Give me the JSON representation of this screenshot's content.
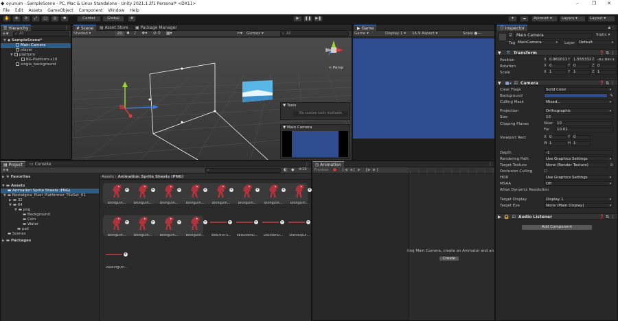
{
  "window": {
    "title": "oyunum - SampleScene - PC, Mac & Linux Standalone - Unity 2021.1.2f1 Personal* <DX11>",
    "controls": [
      "–",
      "❐",
      "✕"
    ]
  },
  "menu": [
    "File",
    "Edit",
    "Assets",
    "GameObject",
    "Component",
    "Window",
    "Help"
  ],
  "toolbar": {
    "pivot_label": "Center",
    "space_label": "Global",
    "account_label": "Account",
    "layers_label": "Layers",
    "layout_label": "Layout"
  },
  "hierarchy": {
    "tab": "Hierarchy",
    "search_placeholder": "All",
    "scene": "SampleScene*",
    "items": [
      {
        "label": "Main Camera",
        "indent": 2,
        "selected": true
      },
      {
        "label": "player",
        "indent": 2
      },
      {
        "label": "platform",
        "indent": 2,
        "expandable": true
      },
      {
        "label": "BG-Platform-x10",
        "indent": 3
      },
      {
        "label": "single_background",
        "indent": 2
      }
    ]
  },
  "scene_view": {
    "tabs": [
      "Scene",
      "Asset Store",
      "Package Manager"
    ],
    "shading": "Shaded",
    "mode_2d": "2D",
    "gizmos": "Gizmos",
    "search_placeholder": "All",
    "persp_label": "< Persp",
    "tools_overlay": {
      "title": "Tools",
      "message": "No custom tools available"
    },
    "camera_preview_title": "Main Camera"
  },
  "game_view": {
    "tab": "Game",
    "game_dropdown": "Game",
    "display": "Display 1",
    "aspect": "16:9 Aspect",
    "scale_label": "Scale"
  },
  "inspector": {
    "tab": "Inspector",
    "object_name": "Main Camera",
    "static_label": "Static",
    "tag_label": "Tag",
    "tag_value": "MainCamera",
    "layer_label": "Layer",
    "layer_value": "Default",
    "transform": {
      "title": "Transform",
      "position": {
        "label": "Position",
        "x": "0.961011",
        "y": "1.555332",
        "z": "-82.8973"
      },
      "rotation": {
        "label": "Rotation",
        "x": "0",
        "y": "0",
        "z": "0"
      },
      "scale": {
        "label": "Scale",
        "x": "1",
        "y": "1",
        "z": "1"
      }
    },
    "camera": {
      "title": "Camera",
      "clear_flags": {
        "label": "Clear Flags",
        "value": "Solid Color"
      },
      "background": {
        "label": "Background",
        "color": "#2f4d8f"
      },
      "culling_mask": {
        "label": "Culling Mask",
        "value": "Mixed..."
      },
      "projection": {
        "label": "Projection",
        "value": "Orthographic"
      },
      "size": {
        "label": "Size",
        "value": "10"
      },
      "clipping": {
        "label": "Clipping Planes",
        "near_label": "Near",
        "near": "10",
        "far_label": "Far",
        "far": "10.01"
      },
      "viewport": {
        "label": "Viewport Rect",
        "x": "0",
        "y": "0",
        "w": "1",
        "h": "1"
      },
      "depth": {
        "label": "Depth",
        "value": "-1"
      },
      "rendering_path": {
        "label": "Rendering Path",
        "value": "Use Graphics Settings"
      },
      "target_texture": {
        "label": "Target Texture",
        "value": "None (Render Texture)"
      },
      "occlusion": {
        "label": "Occlusion Culling"
      },
      "hdr": {
        "label": "HDR",
        "value": "Use Graphics Settings"
      },
      "msaa": {
        "label": "MSAA",
        "value": "Off"
      },
      "dynamic_res": {
        "label": "Allow Dynamic Resolution"
      },
      "target_display": {
        "label": "Target Display",
        "value": "Display 1"
      },
      "target_eye": {
        "label": "Target Eye",
        "value": "None (Main Display)"
      }
    },
    "audio_listener": "Audio Listener",
    "add_component": "Add Component"
  },
  "project": {
    "tabs": [
      "Project",
      "Console"
    ],
    "favorites": "Favorites",
    "assets": "Assets",
    "tree": [
      {
        "label": "Animation Sprite Sheets (PNG)",
        "indent": 1,
        "selected": true
      },
      {
        "label": "Nostalgica_Pixel_Platformer_TileSet_01",
        "indent": 1
      },
      {
        "label": "32",
        "indent": 2
      },
      {
        "label": "64",
        "indent": 2
      },
      {
        "label": "png",
        "indent": 3
      },
      {
        "label": "Background",
        "indent": 4
      },
      {
        "label": "Coin",
        "indent": 4
      },
      {
        "label": "Water",
        "indent": 4
      },
      {
        "label": "psd",
        "indent": 3
      },
      {
        "label": "Scenes",
        "indent": 1
      }
    ],
    "packages": "Packages",
    "breadcrumb": [
      "Assets",
      "Animation Sprite Sheets (PNG)"
    ],
    "count_badge": "19",
    "assets_row1": [
      "BitingDin...",
      "BitingDin...",
      "BitingDin...",
      "BitingDin...",
      "BitingDin...",
      "BitingDin...",
      "BitingDin...",
      "BitingDin..."
    ],
    "assets_row2": [
      "BitingDin...",
      "BitingDin...",
      "BitingDin...",
      "BitingDin...",
      "IdleDino-S...",
      "IdleDownD...",
      "LieDownD...",
      "StandUpDi..."
    ],
    "assets_row3": [
      "WalkingDin..."
    ]
  },
  "animation": {
    "tab": "Animation",
    "preview": "Preview",
    "message": "ting Main Camera, create an Animator and an",
    "create_button": "Create"
  },
  "colors": {
    "accent": "#5a8fd6",
    "selection": "#2c5d87",
    "game_bg": "#2f4d8f",
    "dino": "#b0323a"
  }
}
